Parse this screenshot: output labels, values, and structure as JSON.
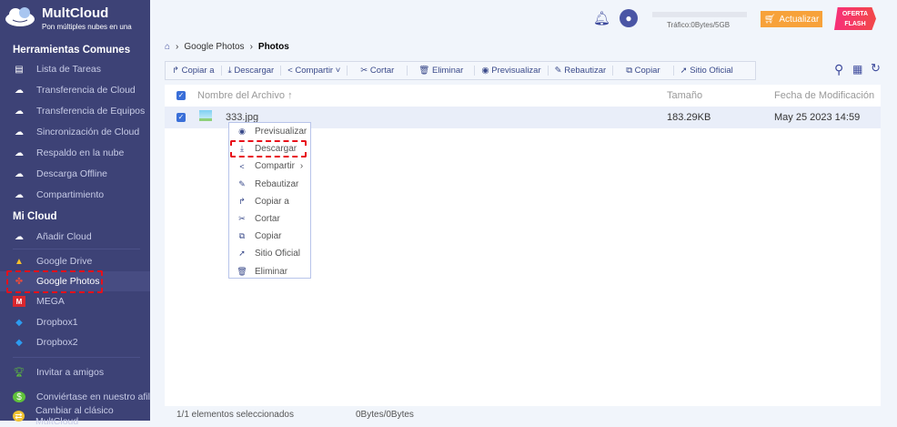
{
  "brand": {
    "name": "MultCloud",
    "slogan": "Pon múltiples nubes en una"
  },
  "sidebar": {
    "section1": "Herramientas Comunes",
    "tools": [
      {
        "label": "Lista de Tareas",
        "icon": "clipboard-icon"
      },
      {
        "label": "Transferencia de Cloud",
        "icon": "cloud-transfer-icon"
      },
      {
        "label": "Transferencia de Equipos",
        "icon": "team-transfer-icon"
      },
      {
        "label": "Sincronización de Cloud",
        "icon": "cloud-sync-icon"
      },
      {
        "label": "Respaldo en la nube",
        "icon": "cloud-backup-icon"
      },
      {
        "label": "Descarga Offline",
        "icon": "offline-download-icon"
      },
      {
        "label": "Compartimiento",
        "icon": "share-icon"
      }
    ],
    "section2": "Mi Cloud",
    "add_cloud": "Añadir Cloud",
    "clouds": [
      {
        "label": "Google Drive"
      },
      {
        "label": "Google Photos"
      },
      {
        "label": "MEGA"
      },
      {
        "label": "Dropbox1"
      },
      {
        "label": "Dropbox2"
      }
    ],
    "extras": [
      {
        "label": "Invitar a amigos"
      },
      {
        "label": "Conviértase en nuestro afil"
      },
      {
        "label": "Cambiar al clásico MultCloud"
      }
    ]
  },
  "header": {
    "traffic": "Tráfico:0Bytes/5GB",
    "upgrade": "Actualizar",
    "flash_line1": "OFERTA",
    "flash_line2": "FLASH"
  },
  "breadcrumb": {
    "parent": "Google Photos",
    "current": "Photos"
  },
  "toolbar": [
    "Copiar a",
    "Descargar",
    "Compartir",
    "Cortar",
    "Eliminar",
    "Previsualizar",
    "Rebautizar",
    "Copiar",
    "Sitio Oficial"
  ],
  "table": {
    "columns": {
      "name": "Nombre del Archivo",
      "size": "Tamaño",
      "date": "Fecha de Modificación"
    },
    "rows": [
      {
        "name": "333.jpg",
        "size": "183.29KB",
        "date": "May 25 2023 14:59"
      }
    ]
  },
  "context_menu": [
    "Previsualizar",
    "Descargar",
    "Compartir",
    "Rebautizar",
    "Copiar a",
    "Cortar",
    "Copiar",
    "Sitio Oficial",
    "Eliminar"
  ],
  "status": {
    "selected": "1/1 elementos seleccionados",
    "bytes": "0Bytes/0Bytes"
  }
}
